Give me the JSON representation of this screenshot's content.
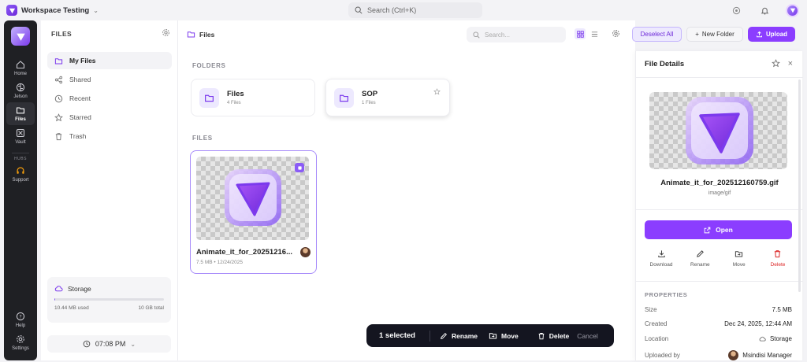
{
  "topbar": {
    "workspace": "Workspace Testing",
    "search_placeholder": "Search (Ctrl+K)"
  },
  "rail": {
    "items": [
      {
        "label": "Home",
        "icon": "home-icon"
      },
      {
        "label": "Jelson",
        "icon": "brain-icon"
      },
      {
        "label": "Files",
        "icon": "folder-icon"
      },
      {
        "label": "Vault",
        "icon": "vault-icon"
      }
    ],
    "hubs_label": "HUBS",
    "support_label": "Support",
    "help_label": "Help",
    "settings_label": "Settings"
  },
  "sidebar": {
    "title": "FILES",
    "items": [
      {
        "label": "My Files",
        "icon": "folder-icon"
      },
      {
        "label": "Shared",
        "icon": "share-icon"
      },
      {
        "label": "Recent",
        "icon": "clock-icon"
      },
      {
        "label": "Starred",
        "icon": "star-icon"
      },
      {
        "label": "Trash",
        "icon": "trash-icon"
      }
    ],
    "storage": {
      "title": "Storage",
      "used": "10.44 MB used",
      "total": "10 GB total",
      "fraction": 0.001
    },
    "clock": "07:08 PM"
  },
  "main": {
    "breadcrumb": "Files",
    "search_placeholder": "Search...",
    "folders_label": "FOLDERS",
    "files_label": "FILES",
    "folders": [
      {
        "name": "Files",
        "count": "4 Files"
      },
      {
        "name": "SOP",
        "count": "1 Files"
      }
    ],
    "file": {
      "name": "Animate_it_for_20251216...",
      "meta": "7.5 MB • 12/24/2025"
    }
  },
  "toolbar": {
    "deselect": "Deselect All",
    "new_folder": "New Folder",
    "upload": "Upload"
  },
  "actionbar": {
    "count": "1 selected",
    "rename": "Rename",
    "move": "Move",
    "delete": "Delete",
    "cancel": "Cancel"
  },
  "details": {
    "title": "File Details",
    "filename": "Animate_it_for_202512160759.gif",
    "filetype": "image/gif",
    "open": "Open",
    "actions": {
      "download": "Download",
      "rename": "Rename",
      "move": "Move",
      "delete": "Delete"
    },
    "properties_label": "PROPERTIES",
    "props": {
      "size_k": "Size",
      "size_v": "7.5 MB",
      "created_k": "Created",
      "created_v": "Dec 24, 2025, 12:44 AM",
      "location_k": "Location",
      "location_v": "Storage",
      "uploaded_k": "Uploaded by",
      "uploaded_v": "Msindisi Manager"
    }
  },
  "colors": {
    "accent": "#8b3dff",
    "rail_bg": "#1f2024",
    "danger": "#dc2626"
  }
}
